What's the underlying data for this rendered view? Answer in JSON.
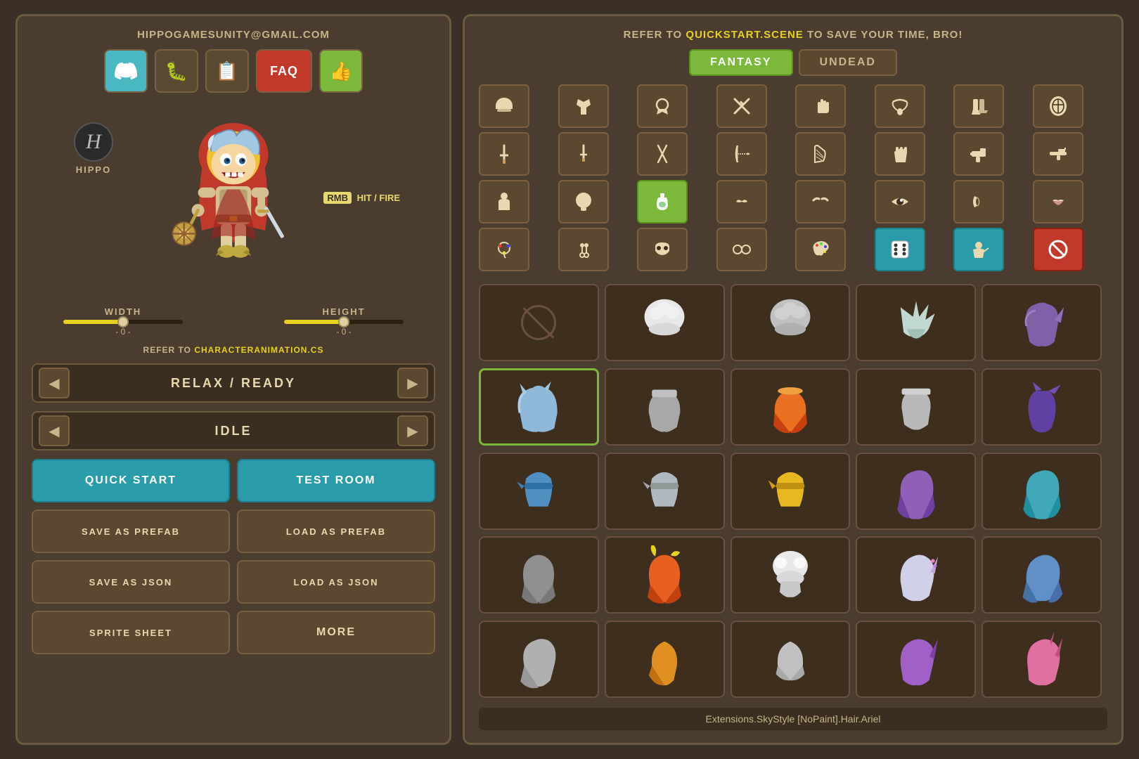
{
  "left": {
    "email": "HIPPOGAMESUNITY@GMAIL.COM",
    "buttons": {
      "discord_icon": "💬",
      "bug_icon": "🐛",
      "clipboard_icon": "📋",
      "faq_label": "FAQ",
      "thumb_icon": "👍"
    },
    "hippo_label": "HIPPO",
    "rmb_label": "[RMB] HIT / FIRE",
    "rmb_key": "RMB",
    "width_label": "WIDTH",
    "height_label": "HEIGHT",
    "width_value": "- 0 -",
    "height_value": "- 0 -",
    "refer_text": "REFER TO",
    "refer_file": "CHARACTERANIMATION.CS",
    "animation1": "RELAX / READY",
    "animation2": "IDLE",
    "quick_start": "QUICK START",
    "test_room": "TEST ROOM",
    "save_prefab": "SAVE AS PREFAB",
    "load_prefab": "LOAD AS PREFAB",
    "save_json": "SAVE AS JSON",
    "load_json": "LOAD AS JSON",
    "sprite_sheet": "SPRITE SHEET",
    "more": "MORE"
  },
  "right": {
    "header_text": "REFER TO",
    "header_file": "QUICKSTART.SCENE",
    "header_suffix": " TO SAVE YOUR TIME, BRO!",
    "tab_fantasy": "FANTASY",
    "tab_undead": "UNDEAD",
    "status_bar": "Extensions.SkyStyle [NoPaint].Hair.Ariel",
    "icon_rows": [
      [
        "helmet",
        "armor",
        "shield-hand",
        "crossed-swords",
        "hand",
        "necklace",
        "boots",
        "round-shield"
      ],
      [
        "sword",
        "dagger",
        "dual-swords",
        "bow",
        "harp",
        "glove",
        "gun",
        "rifle"
      ],
      [
        "body",
        "head",
        "bottle",
        "mustache",
        "eyebrows",
        "eye",
        "ear",
        "lips"
      ],
      [
        "paint",
        "earring",
        "mask",
        "glasses",
        "palette",
        "dice",
        "fight",
        "ban"
      ]
    ]
  }
}
